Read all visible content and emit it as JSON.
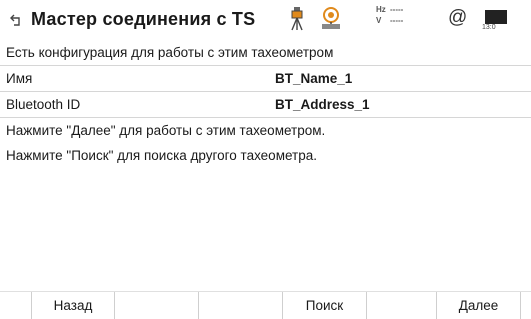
{
  "header": {
    "title": "Мастер соединения с TS",
    "back_icon": "back-arrow-icon",
    "hz_label": "Hz",
    "hz_value": "-----",
    "v_label": "V",
    "v_value": "-----",
    "at_symbol": "@",
    "time": "13:0"
  },
  "config": {
    "heading": "Есть конфигурация для работы с этим тахеометром",
    "fields": [
      {
        "label": "Имя",
        "value": "BT_Name_1"
      },
      {
        "label": "Bluetooth ID",
        "value": "BT_Address_1"
      }
    ]
  },
  "messages": {
    "next_hint": "Нажмите \"Далее\" для работы с этим тахеометром.",
    "search_hint": "Нажмите \"Поиск\" для поиска другого тахеометра."
  },
  "softkeys": {
    "back": "Назад",
    "search": "Поиск",
    "next": "Далее"
  },
  "colors": {
    "accent_orange": "#e08a1c",
    "text": "#1a1a1a",
    "divider": "#d6d6d6"
  }
}
